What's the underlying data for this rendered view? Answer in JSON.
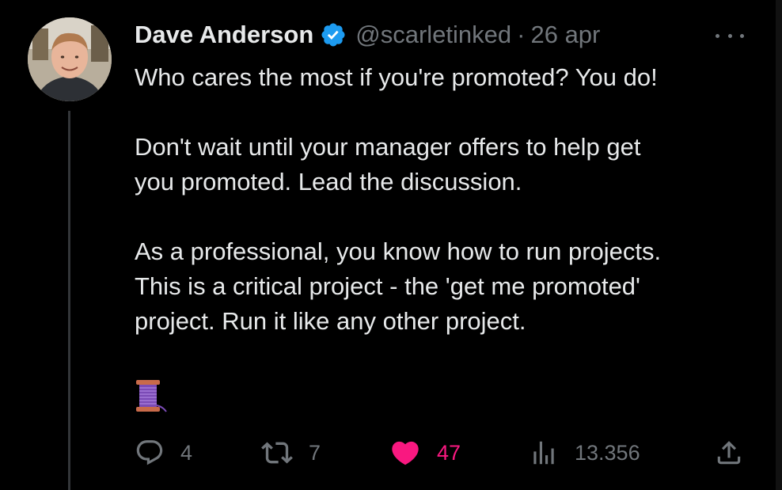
{
  "tweet": {
    "author_name": "Dave Anderson",
    "handle": "@scarletinked",
    "separator": "·",
    "date": "26 apr",
    "paragraphs": [
      [
        "Who cares the most if you're promoted? You do!"
      ],
      [
        "Don't wait until your manager offers to help get",
        "you promoted. Lead the discussion."
      ],
      [
        "As a professional, you know how to run projects.",
        "This is a critical project - the 'get me promoted'",
        "project. Run it like any other project."
      ]
    ],
    "emoji": "🧵"
  },
  "actions": {
    "replies": "4",
    "reposts": "7",
    "likes": "47",
    "views": "13.356"
  },
  "icons": {
    "verified": "verified-badge-icon",
    "more": "more-dots-icon",
    "reply": "reply-icon",
    "repost": "repost-icon",
    "like": "heart-icon",
    "views": "views-bar-chart-icon",
    "share": "share-upload-icon"
  },
  "colors": {
    "background": "#000000",
    "text": "#e7e9ea",
    "muted": "#71767b",
    "verified_blue": "#1d9bf0",
    "like_pink": "#f91880",
    "thread_line": "#333639"
  }
}
